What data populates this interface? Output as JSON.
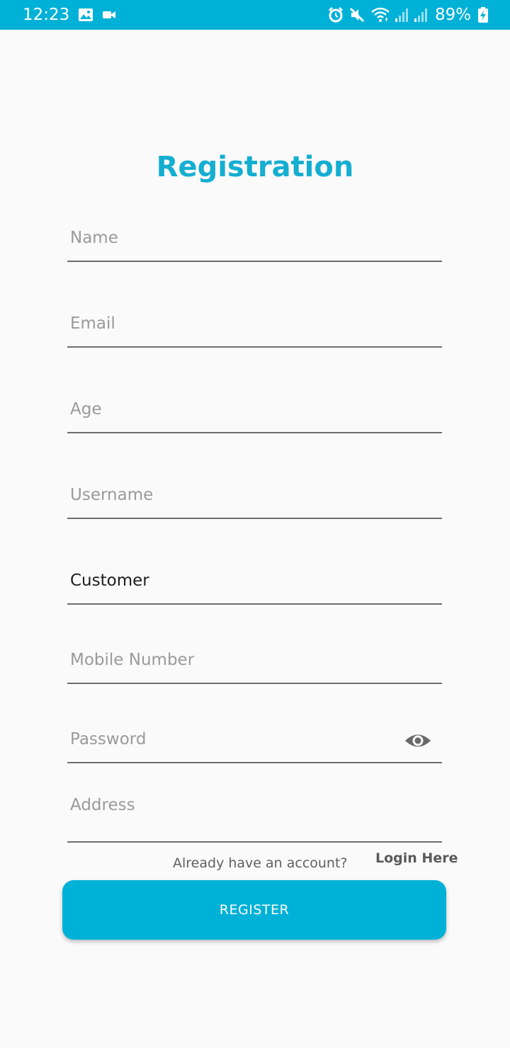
{
  "status_bar": {
    "time": "12:23",
    "battery_percent": "89%",
    "background_color": "#00b1d7",
    "icons": [
      "gallery-icon",
      "video-icon",
      "alarm-icon",
      "mute-icon",
      "wifi-icon",
      "signal-icon",
      "signal-icon",
      "battery-charging-icon"
    ]
  },
  "page": {
    "title": "Registration",
    "accent_color": "#14aed1"
  },
  "form": {
    "name": {
      "placeholder": "Name",
      "value": ""
    },
    "email": {
      "placeholder": "Email",
      "value": ""
    },
    "age": {
      "placeholder": "Age",
      "value": ""
    },
    "username": {
      "placeholder": "Username",
      "value": ""
    },
    "role": {
      "value": "Customer"
    },
    "mobile": {
      "placeholder": "Mobile Number",
      "value": ""
    },
    "password": {
      "placeholder": "Password",
      "value": "",
      "toggle_icon": "eye-icon"
    },
    "address": {
      "placeholder": "Address",
      "value": ""
    }
  },
  "footer": {
    "already_text": "Already have an account?",
    "login_label": "Login Here",
    "register_label": "REGISTER"
  }
}
